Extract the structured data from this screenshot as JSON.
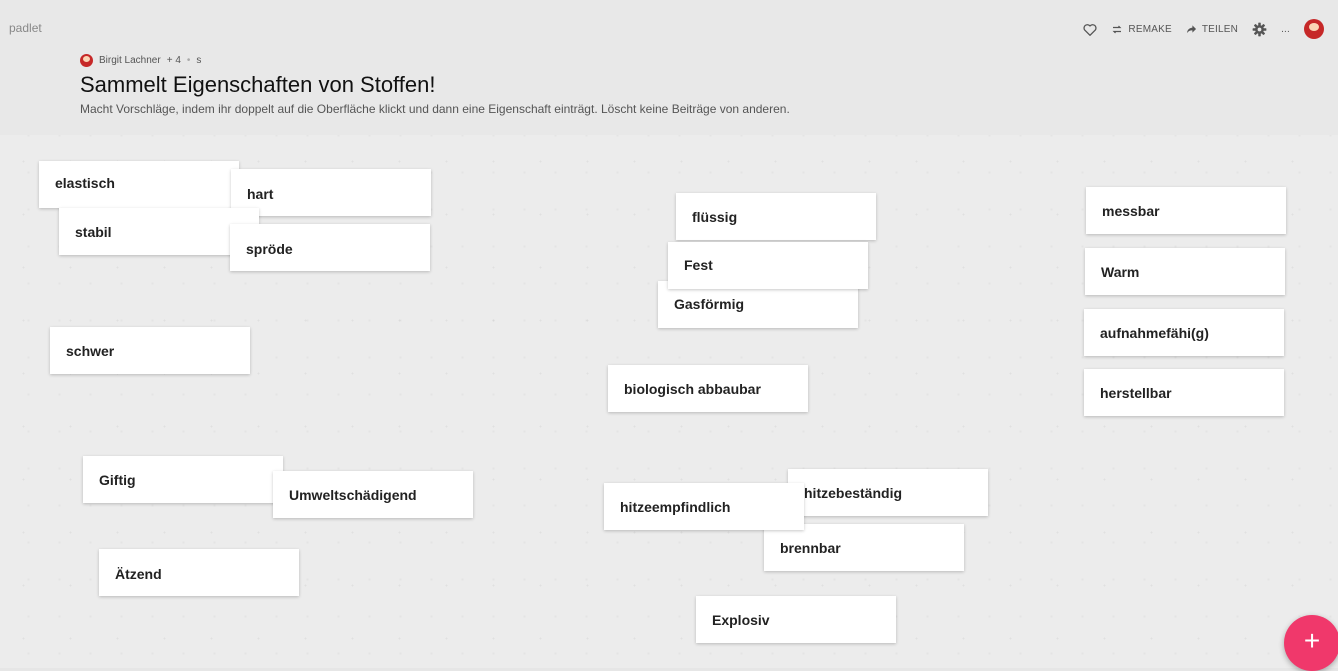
{
  "app": {
    "logo": "padlet"
  },
  "header": {
    "author_name": "Birgit Lachner",
    "contributor_count": "+ 4",
    "separator": "•",
    "time": "s",
    "title": "Sammelt Eigenschaften von Stoffen!",
    "description": "Macht Vorschläge, indem ihr doppelt auf die Oberfläche klickt und dann eine Eigenschaft einträgt. Löscht keine Beiträge von anderen."
  },
  "toolbar": {
    "remake_label": "REMAKE",
    "share_label": "TEILEN",
    "more_label": "..."
  },
  "icons": {
    "like": "heart-icon",
    "remake": "remake-icon",
    "share": "share-icon",
    "settings": "gear-icon",
    "add": "plus-icon"
  },
  "colors": {
    "header_bg": "#e8e8e8",
    "board_bg": "#ececec",
    "card_bg": "#ffffff",
    "fab": "#f0386b",
    "avatar": "#c62828"
  },
  "posts": [
    "elastisch",
    "hart",
    "stabil",
    "spröde",
    "schwer",
    "flüssig",
    "Fest",
    "Gasförmig",
    "biologisch abbaubar",
    "messbar",
    "Warm",
    "aufnahmefähi(g)",
    "herstellbar",
    "Giftig",
    "Umweltschädigend",
    "hitzebeständig",
    "hitzeempfindlich",
    "brennbar",
    "Ätzend",
    "Explosiv"
  ],
  "fab_label": "+"
}
